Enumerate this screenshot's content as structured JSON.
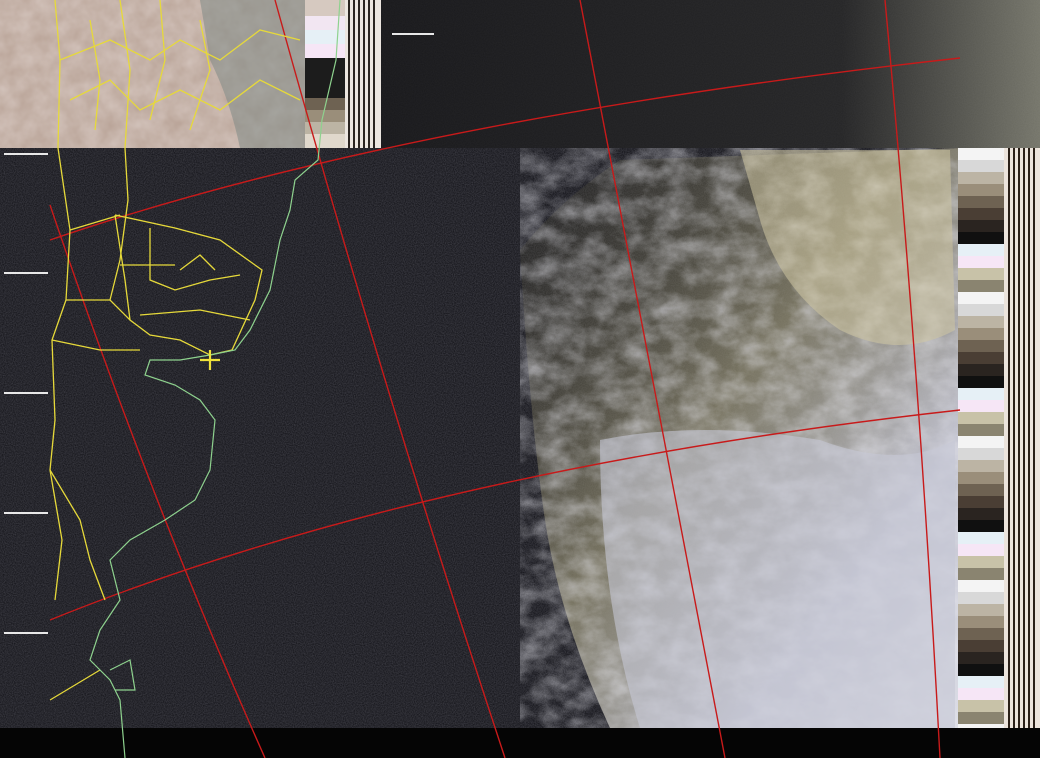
{
  "image": {
    "kind": "weather satellite image (APT decode) with map overlay",
    "text_visible": []
  },
  "colors": {
    "background": "#000000",
    "ocean_noise": "#121218",
    "land_overlay_border": "#e6d93a",
    "coastline": "#8ed28e",
    "graticule": "#c81a1a",
    "cloud_light": "#cfd2e0",
    "cloud_warm": "#c9c19a",
    "cloud_shadow": "#3a3a30",
    "marker": "#f0e23a"
  },
  "icons": {
    "location_marker": "crosshair-plus"
  },
  "telemetry_wedges": [
    "#f4f4f4",
    "#d8d8d8",
    "#bcb4a4",
    "#9a8e7a",
    "#6e6252",
    "#4a3e34",
    "#2a2420",
    "#101010",
    "#e6f0f6",
    "#f6e6f6",
    "#c8c2a8",
    "#8a8470"
  ]
}
